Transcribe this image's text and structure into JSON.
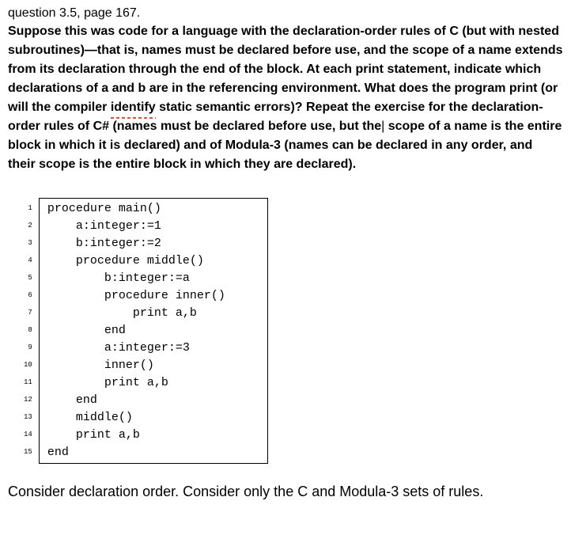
{
  "header": "question 3.5, page 167.",
  "body": {
    "p1": "Suppose this was code for a language with the declaration-order rules of C (but with nested subroutines)—that is, names must be declared before use, and the scope of a name extends from its declaration through the end of the block. At each print statement, indicate which declarations of a and b are in the referencing environment. What does the program print (or will the compiler ",
    "identify": "identify",
    "p2": " static semantic errors)? Repeat the exercise for the declaration-order rules of C# (names must be declared before use, but the",
    "cursor": "|",
    "p3": " scope of a name is the entire block in which it is declared) and of Modula-3 (names can be declared in any order, and their scope is the entire block in which they are declared)."
  },
  "code": {
    "lines": [
      {
        "n": "1",
        "t": "procedure main()"
      },
      {
        "n": "2",
        "t": "    a:integer:=1"
      },
      {
        "n": "3",
        "t": "    b:integer:=2"
      },
      {
        "n": "4",
        "t": "    procedure middle()"
      },
      {
        "n": "5",
        "t": "        b:integer:=a"
      },
      {
        "n": "6",
        "t": "        procedure inner()"
      },
      {
        "n": "7",
        "t": "            print a,b"
      },
      {
        "n": "8",
        "t": "        end"
      },
      {
        "n": "9",
        "t": "        a:integer:=3"
      },
      {
        "n": "10",
        "t": "        inner()"
      },
      {
        "n": "11",
        "t": "        print a,b"
      },
      {
        "n": "12",
        "t": "    end"
      },
      {
        "n": "13",
        "t": "    middle()"
      },
      {
        "n": "14",
        "t": "    print a,b"
      },
      {
        "n": "15",
        "t": "end"
      }
    ]
  },
  "footer": "Consider declaration order. Consider only the C and Modula-3 sets of rules."
}
